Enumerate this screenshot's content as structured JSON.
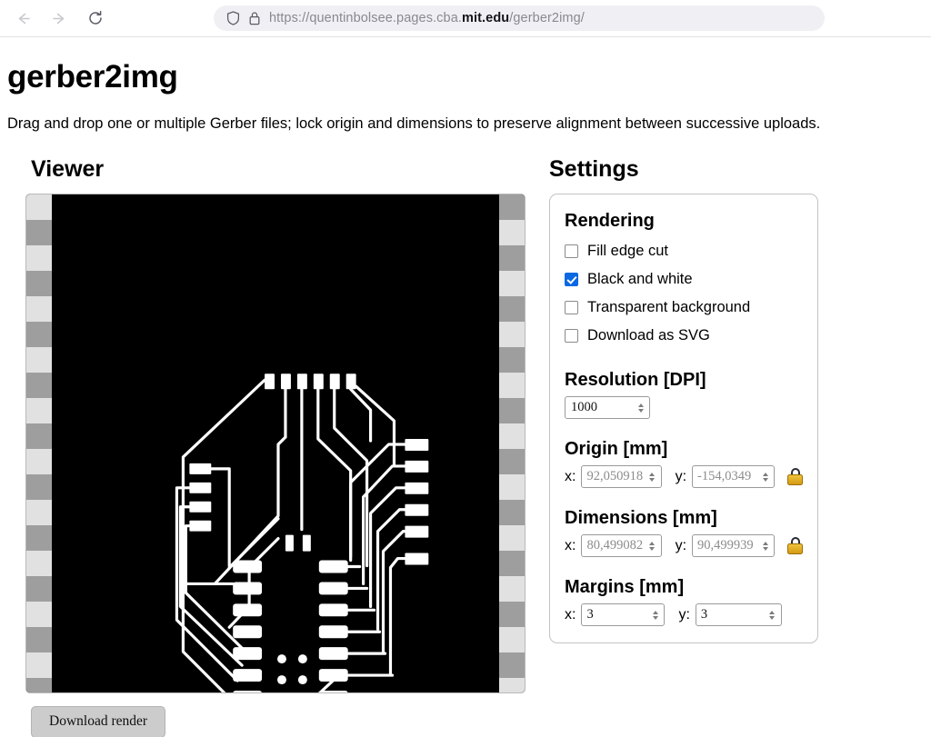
{
  "browser": {
    "back_icon": "back-arrow-icon",
    "forward_icon": "forward-arrow-icon",
    "reload_icon": "reload-icon",
    "shield_icon": "shield-icon",
    "lock_icon": "padlock-icon",
    "url_prefix": "https://quentinbolsee.pages.cba.",
    "url_domain": "mit.edu",
    "url_suffix": "/gerber2img/"
  },
  "page": {
    "title": "gerber2img",
    "subtitle": "Drag and drop one or multiple Gerber files; lock origin and dimensions to preserve alignment between successive uploads."
  },
  "viewer": {
    "heading": "Viewer",
    "download_button": "Download render",
    "background_color": "#000000",
    "trace_color": "#ffffff",
    "checker_light": "#e1e1e1",
    "checker_dark": "#9e9e9e"
  },
  "settings": {
    "heading": "Settings",
    "rendering": {
      "heading": "Rendering",
      "options": [
        {
          "label": "Fill edge cut",
          "checked": false
        },
        {
          "label": "Black and white",
          "checked": true
        },
        {
          "label": "Transparent background",
          "checked": false
        },
        {
          "label": "Download as SVG",
          "checked": false
        }
      ],
      "checked_color": "#0b68e3"
    },
    "resolution": {
      "heading": "Resolution [DPI]",
      "value": "1000"
    },
    "origin": {
      "heading": "Origin [mm]",
      "x_label": "x:",
      "x_value": "92,050918",
      "y_label": "y:",
      "y_value": "-154,0349",
      "locked": true,
      "lock_icon": "lock-closed-icon"
    },
    "dimensions": {
      "heading": "Dimensions [mm]",
      "x_label": "x:",
      "x_value": "80,499082",
      "y_label": "y:",
      "y_value": "90,499939",
      "locked": true,
      "lock_icon": "lock-closed-icon"
    },
    "margins": {
      "heading": "Margins [mm]",
      "x_label": "x:",
      "x_value": "3",
      "y_label": "y:",
      "y_value": "3"
    }
  }
}
